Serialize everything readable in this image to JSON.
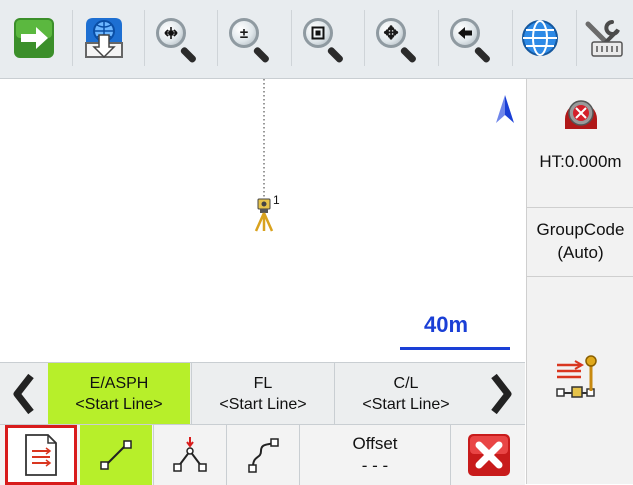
{
  "toolbar": {
    "icons": [
      "next-arrow-icon",
      "download-map-icon",
      "zoom-extents-icon",
      "zoom-in-out-icon",
      "zoom-window-icon",
      "pan-icon",
      "zoom-previous-icon",
      "globe-icon",
      "settings-tools-icon"
    ],
    "zoom_in_out_glyph": "±",
    "pan_glyph": "✥"
  },
  "map": {
    "point_label": "1",
    "north_arrow": "▲",
    "scale_label": "40m",
    "accent_blue": "#1a3fd6"
  },
  "right_panel": {
    "hi_label": "HT:0.000m",
    "group_label_line1": "GroupCode",
    "group_label_line2": "(Auto)"
  },
  "line_selector": {
    "cells": [
      {
        "title": "E/ASPH",
        "value": "<Start Line>",
        "active": true
      },
      {
        "title": "FL",
        "value": "<Start Line>",
        "active": false
      },
      {
        "title": "C/L",
        "value": "<Start Line>",
        "active": false
      }
    ],
    "active_color": "#b7ef2a"
  },
  "bottom_row": {
    "offset_label": "Offset",
    "offset_value": "- - -"
  }
}
